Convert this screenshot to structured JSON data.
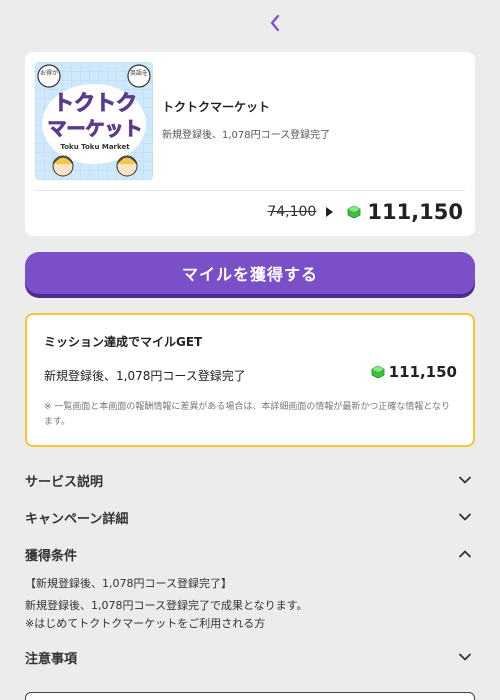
{
  "nav": {
    "back_icon": "chevron-left-icon"
  },
  "offer": {
    "title": "トクトクマーケット",
    "subtitle": "新規登録後、1,078円コース登録完了",
    "old_price": "74,100",
    "new_price": "111,150",
    "thumb": {
      "badge_left": "お得が",
      "badge_right": "英語を",
      "logo_line1": "トクトク",
      "logo_line2": "マーケット",
      "logo_en": "Toku Toku Market"
    }
  },
  "cta": {
    "label": "マイルを獲得する"
  },
  "mission": {
    "title": "ミッション達成でマイルGET",
    "condition": "新規登録後、1,078円コース登録完了",
    "points": "111,150",
    "note": "※ 一覧画面と本画面の報酬情報に差異がある場合は、本詳細画面の情報が最新かつ正確な情報となります。"
  },
  "sections": {
    "service": "サービス説明",
    "campaign": "キャンペーン詳細",
    "conditions": "獲得条件",
    "cautions": "注意事項"
  },
  "conditions_detail": {
    "line1": "【新規登録後、1,078円コース登録完了】",
    "line2": "新規登録後、1,078円コース登録完了で成果となります。",
    "line3": "※はじめてトクトクマーケットをご利用される方"
  },
  "colors": {
    "accent": "#7a4fc8",
    "mission_border": "#f4c43a",
    "gem": "#3cc23c"
  }
}
